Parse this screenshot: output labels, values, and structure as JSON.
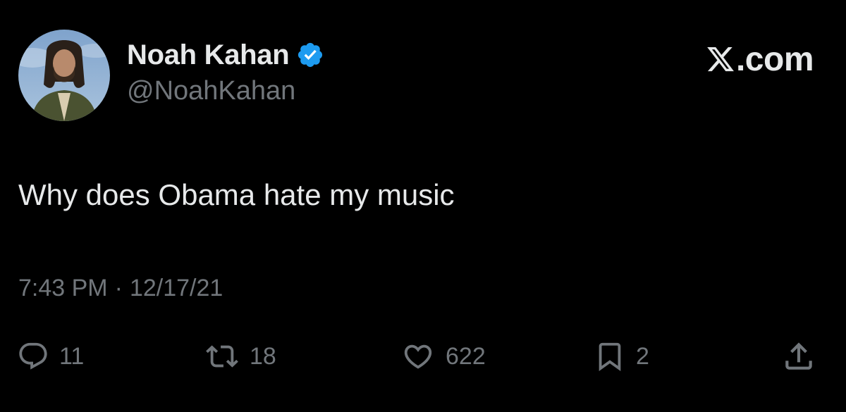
{
  "author": {
    "display_name": "Noah Kahan",
    "handle": "@NoahKahan",
    "verified": true,
    "avatar_icon": "profile-photo"
  },
  "brand": {
    "label": ".com",
    "logo_icon": "x-logo-icon"
  },
  "tweet": {
    "text": "Why does Obama hate my music",
    "time": "7:43 PM",
    "separator": "·",
    "date": "12/17/21"
  },
  "actions": {
    "reply_count": "11",
    "retweet_count": "18",
    "like_count": "622",
    "bookmark_count": "2"
  },
  "colors": {
    "background": "#000000",
    "primary_text": "#e7e9ea",
    "secondary_text": "#71767b",
    "verified_badge": "#1d9bf0"
  }
}
